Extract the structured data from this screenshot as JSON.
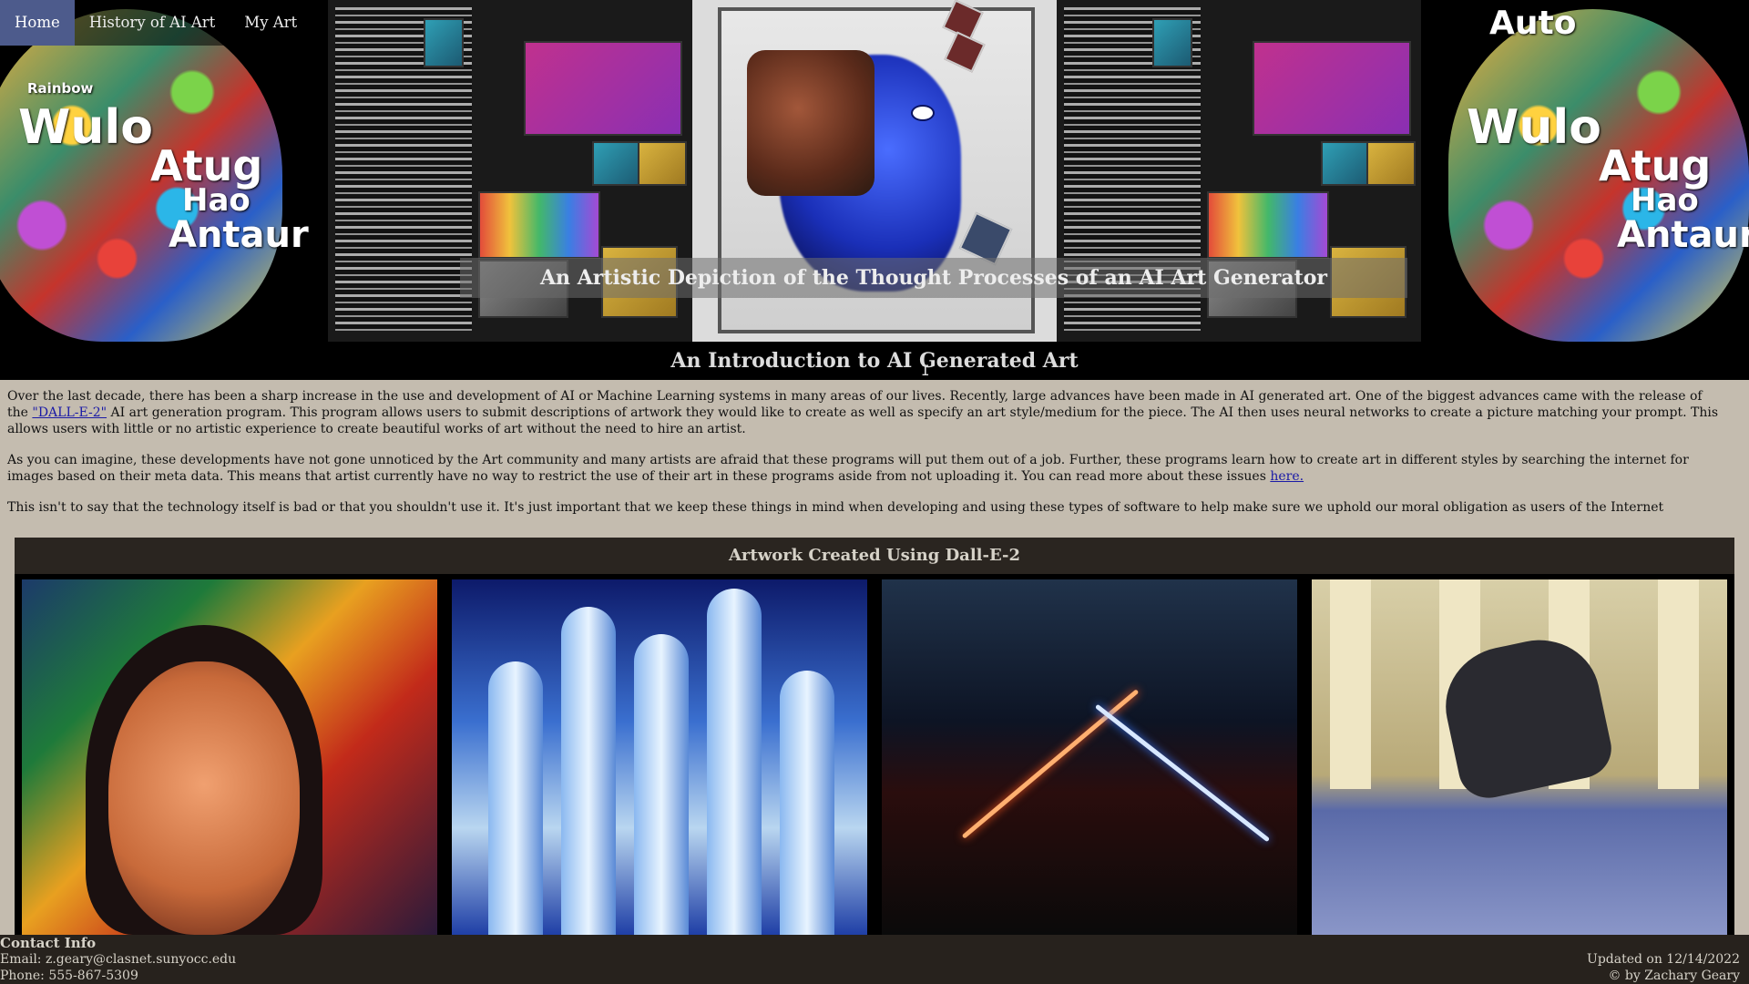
{
  "nav": {
    "items": [
      {
        "label": "Home",
        "active": true
      },
      {
        "label": "History of AI Art",
        "active": false
      },
      {
        "label": "My Art",
        "active": false
      }
    ]
  },
  "banner": {
    "caption": "An Artistic Depiction of the Thought Processes of an AI Art Generator",
    "head_words": [
      "Auto",
      "Wulo",
      "Atug",
      "Hao",
      "Antaur",
      "Rainbow"
    ]
  },
  "intro": {
    "title": "An Introduction to AI Generated Art",
    "p1_before": "Over the last decade, there has been a sharp increase in the use and development of AI or Machine Learning systems in many areas of our lives. Recently, large advances have been made in AI generated art. One of the biggest advances came with the release of the ",
    "p1_link": "\"DALL-E-2\"",
    "p1_after": " AI art generation program. This program allows users to submit descriptions of artwork they would like to create as well as specify an art style/medium for the piece. The AI then uses neural networks to create a picture matching your prompt. This allows users with little or no artistic experience to create beautiful works of art without the need to hire an artist.",
    "p2_before": "As you can imagine, these developments have not gone unnoticed by the Art community and many artists are afraid that these programs will put them out of a job. Further, these programs learn how to create art in different styles by searching the internet for images based on their meta data. This means that artist currently have no way to restrict the use of their art in these programs aside from not uploading it. You can read more about these issues ",
    "p2_link": "here.",
    "p3": "This isn't to say that the technology itself is bad or that you shouldn't use it. It's just important that we keep these things in mind when developing and using these types of software to help make sure we uphold our moral obligation as users of the Internet"
  },
  "gallery": {
    "title": "Artwork Created Using Dall-E-2"
  },
  "footer": {
    "heading": "Contact Info",
    "email": "Email: z.geary@clasnet.sunyocc.edu",
    "phone": "Phone: 555-867-5309",
    "updated": "Updated on 12/14/2022",
    "copyright": "© by Zachary Geary"
  }
}
